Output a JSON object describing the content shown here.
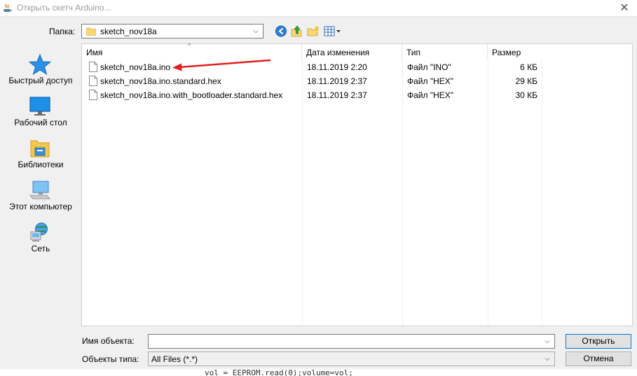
{
  "window": {
    "title": "Открыть скетч Arduino...",
    "close_glyph": "✕"
  },
  "location": {
    "label": "Папка:",
    "value": "sketch_nov18a"
  },
  "places": [
    {
      "label": "Быстрый доступ",
      "icon": "star-icon"
    },
    {
      "label": "Рабочий стол",
      "icon": "desktop-icon"
    },
    {
      "label": "Библиотеки",
      "icon": "libraries-icon"
    },
    {
      "label": "Этот компьютер",
      "icon": "computer-icon"
    },
    {
      "label": "Сеть",
      "icon": "network-icon"
    }
  ],
  "columns": {
    "name": "Имя",
    "date": "Дата изменения",
    "type": "Тип",
    "size": "Размер"
  },
  "files": [
    {
      "name": "sketch_nov18a.ino",
      "date": "18.11.2019 2:20",
      "type": "Файл \"INO\"",
      "size": "6 КБ"
    },
    {
      "name": "sketch_nov18a.ino.standard.hex",
      "date": "18.11.2019 2:37",
      "type": "Файл \"HEX\"",
      "size": "29 КБ"
    },
    {
      "name": "sketch_nov18a.ino.with_bootloader.standard.hex",
      "date": "18.11.2019 2:37",
      "type": "Файл \"HEX\"",
      "size": "30 КБ"
    }
  ],
  "filename": {
    "label": "Имя объекта:",
    "value": ""
  },
  "filetype": {
    "label": "Объекты типа:",
    "value": "All Files (*.*)"
  },
  "buttons": {
    "open": "Открыть",
    "cancel": "Отмена"
  },
  "background_code": "vol = EEPROM.read(0);volume=vol;",
  "colors": {
    "accent": "#0078d7",
    "annotation_arrow": "#e02020"
  }
}
